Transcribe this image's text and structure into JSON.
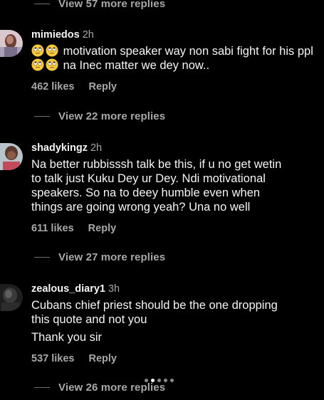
{
  "view_replies": [
    {
      "label": "View 57 more replies"
    },
    {
      "label": "View 22 more replies"
    },
    {
      "label": "View 27 more replies"
    },
    {
      "label": "View 26 more replies"
    }
  ],
  "comments": [
    {
      "username": "mimiedos",
      "time": "2h",
      "text_a": "motivation speaker way non sabi fight for his ppl",
      "text_b": "na Inec matter we dey now..",
      "likes": "462 likes",
      "reply": "Reply",
      "emoji": "face-with-rolling-eyes-icon"
    },
    {
      "username": "shadykingz",
      "time": "2h",
      "lines": [
        "Na better rubbisssh talk be this, if u no get wetin",
        "to talk just Kuku Dey ur Dey. Ndi motivational",
        "speakers. So na to deey humble even when",
        "things are going wrong yeah? Una no well"
      ],
      "likes": "611 likes",
      "reply": "Reply"
    },
    {
      "username": "zealous_diary1",
      "time": "3h",
      "lines": [
        "Cubans chief priest should be the one dropping",
        "this quote and not you",
        "Thank you sir"
      ],
      "likes": "537 likes",
      "reply": "Reply"
    }
  ],
  "colors": {
    "background": "#000000",
    "primary_text": "#f5f5f5",
    "secondary_text": "#a8a8a8",
    "divider": "#6e6e6e"
  },
  "pager": {
    "total": 5,
    "active": 2
  }
}
